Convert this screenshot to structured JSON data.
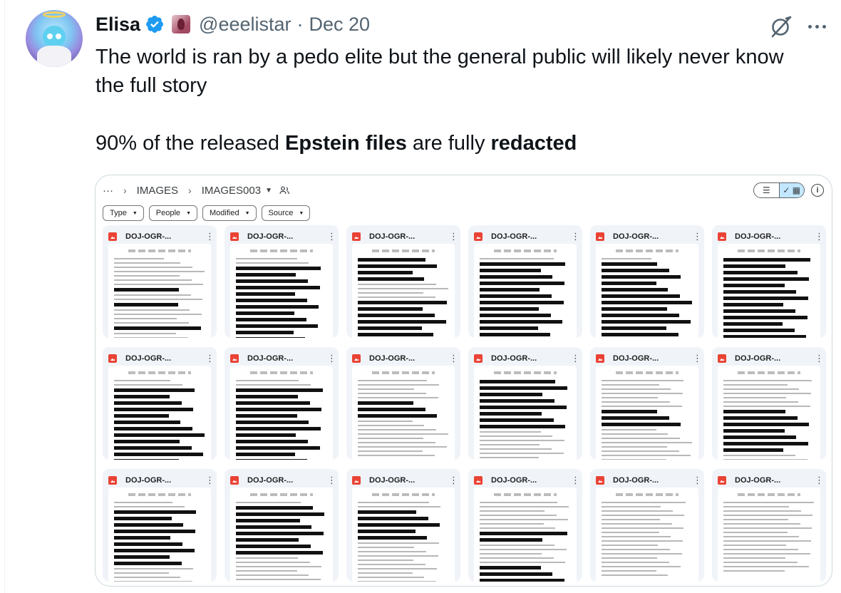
{
  "tweet": {
    "author": {
      "display_name": "Elisa",
      "handle": "@eeelistar",
      "date": "Dec 20",
      "separator": "·"
    },
    "text": {
      "line1": "The world is ran by a pedo elite but the general public will likely never know",
      "line2": "the full story",
      "p2_a": "90% of the released ",
      "p2_b": "Epstein files",
      "p2_c": " are fully ",
      "p2_d": "redacted"
    },
    "icons": {
      "verified": "verified-badge-icon",
      "grok": "grok-icon",
      "more": "more-icon"
    },
    "colors": {
      "verified": "#1d9bf0",
      "secondary_text": "#536471"
    }
  },
  "drive": {
    "breadcrumb": [
      "IMAGES",
      "IMAGES003"
    ],
    "breadcrumb_more": "···",
    "sep": "›",
    "view_list_icon": "☰",
    "view_grid_icon": "✓ ▦",
    "info_icon": "i",
    "filters": [
      "Type",
      "People",
      "Modified",
      "Source"
    ],
    "file_name": "DOJ-OGR-...",
    "card_count": 18
  }
}
